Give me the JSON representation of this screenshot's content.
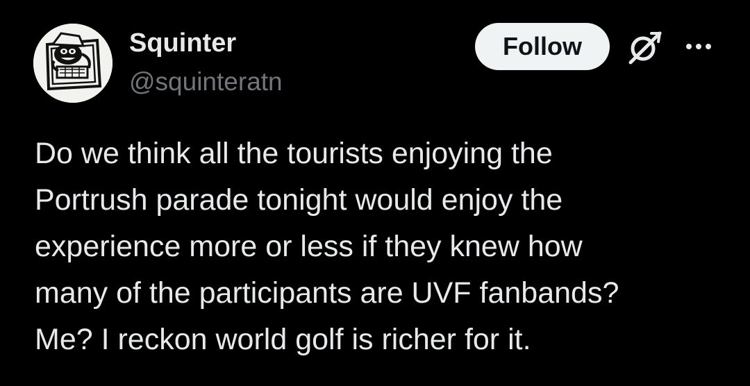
{
  "author": {
    "display_name": "Squinter",
    "handle": "@squinteratn",
    "avatar_icon": "cartoon-avatar"
  },
  "actions": {
    "follow_label": "Follow",
    "grok_icon": "grok-icon",
    "more_icon": "more-options-icon"
  },
  "tweet": {
    "lines": [
      "Do we think all the tourists enjoying the",
      "Portrush parade tonight would enjoy the",
      "experience more or less if they knew how",
      "many of the participants are UVF fanbands?",
      "Me? I reckon world golf is richer for it."
    ]
  },
  "colors": {
    "background": "#000000",
    "primary_text": "#e7e9ea",
    "secondary_text": "#71767b",
    "follow_button_bg": "#eff3f4",
    "follow_button_text": "#0f1419"
  }
}
